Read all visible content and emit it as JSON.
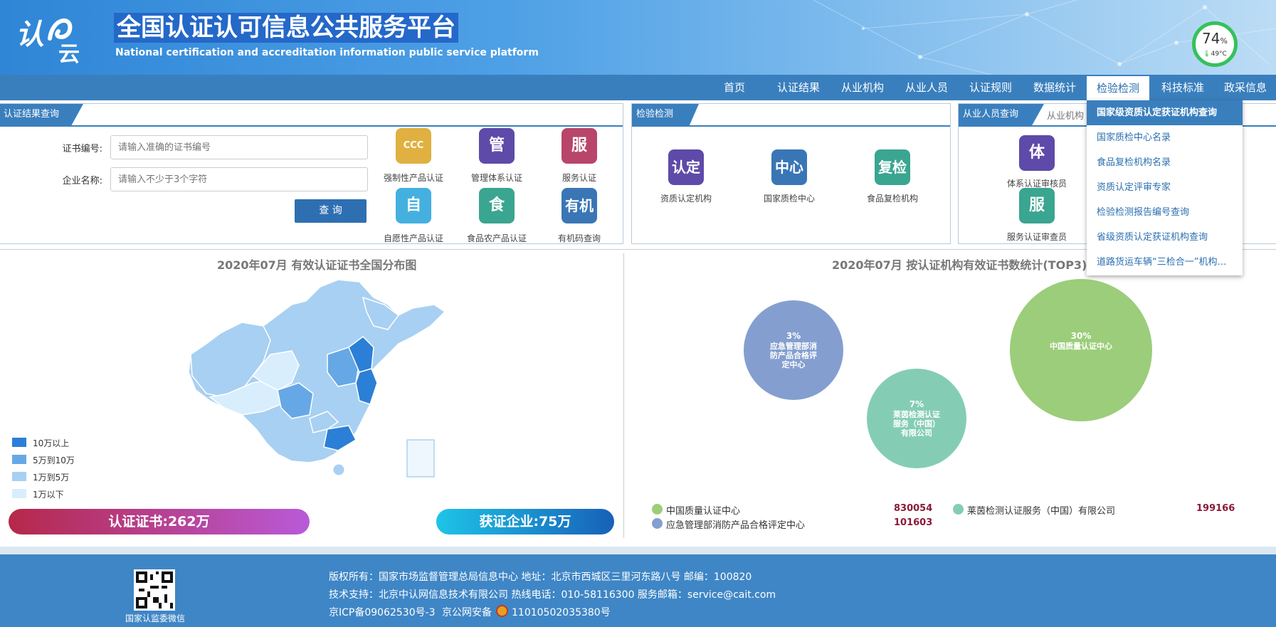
{
  "header": {
    "title_cn": "全国认证认可信息公共服务平台",
    "title_en": "National certification and accreditation information public service platform",
    "logo_text": "认e云",
    "gauge": {
      "percent": "74",
      "percent_unit": "%",
      "temp": "49°C"
    }
  },
  "nav": [
    {
      "label": "首页"
    },
    {
      "label": "认证结果"
    },
    {
      "label": "从业机构"
    },
    {
      "label": "从业人员"
    },
    {
      "label": "认证规则"
    },
    {
      "label": "数据统计"
    },
    {
      "label": "检验检测"
    },
    {
      "label": "科技标准"
    },
    {
      "label": "政采信息"
    }
  ],
  "dropdown": [
    {
      "label": "国家级资质认定获证机构查询"
    },
    {
      "label": "国家质检中心名录"
    },
    {
      "label": "食品复检机构名录"
    },
    {
      "label": "资质认定评审专家"
    },
    {
      "label": "检验检测报告编号查询"
    },
    {
      "label": "省级资质认定获证机构查询"
    },
    {
      "label": "道路货运车辆“三检合一”机构…"
    }
  ],
  "panel1": {
    "tab": "认证结果查询",
    "cert_label": "证书编号:",
    "cert_placeholder": "请输入准确的证书编号",
    "company_label": "企业名称:",
    "company_placeholder": "请输入不少于3个字符",
    "query_button": "查 询",
    "icons": [
      {
        "glyph": "CCC",
        "caption": "强制性产品认证",
        "color": "#e0b040"
      },
      {
        "glyph": "管",
        "caption": "管理体系认证",
        "color": "#5e4aa8"
      },
      {
        "glyph": "服",
        "caption": "服务认证",
        "color": "#b8466a"
      },
      {
        "glyph": "自",
        "caption": "自愿性产品认证",
        "color": "#44b0e0"
      },
      {
        "glyph": "食",
        "caption": "食品农产品认证",
        "color": "#3aa590"
      },
      {
        "glyph": "有机",
        "caption": "有机码查询",
        "color": "#3a76b5"
      }
    ]
  },
  "panel2": {
    "tab": "检验检测",
    "icons": [
      {
        "glyph": "认定",
        "caption": "资质认定机构",
        "color": "#5e4aa8"
      },
      {
        "glyph": "中心",
        "caption": "国家质检中心",
        "color": "#3a76b5"
      },
      {
        "glyph": "复检",
        "caption": "食品复检机构",
        "color": "#3aa590"
      }
    ]
  },
  "panel3": {
    "tab": "从业人员查询",
    "tab2": "从业机构",
    "icons": [
      {
        "glyph": "体",
        "caption": "体系认证审核员",
        "color": "#5e4aa8"
      },
      {
        "glyph": "服",
        "caption": "服务认证审查员",
        "color": "#3aa590"
      }
    ]
  },
  "map_section": {
    "title": "2020年07月  有效认证证书全国分布图",
    "legend": [
      {
        "label": "10万以上",
        "color": "#2b7fd6"
      },
      {
        "label": "5万到10万",
        "color": "#66a8e6"
      },
      {
        "label": "1万到5万",
        "color": "#a8d0f2"
      },
      {
        "label": "1万以下",
        "color": "#d8eefc"
      }
    ],
    "cert_total": "认证证书:262万",
    "company_total": "获证企业:75万"
  },
  "chart_data": {
    "type": "bubble",
    "title": "2020年07月   按认证机构有效证书数统计(TOP3)",
    "series": [
      {
        "name": "中国质量认证中心",
        "value": 830054,
        "percent": "30%",
        "bubble_label": "中国质量认证中心",
        "color": "#9ccd7a"
      },
      {
        "name": "莱茵检测认证服务（中国）有限公司",
        "value": 199166,
        "percent": "7%",
        "bubble_label": "莱茵检测认证服务（中国）有限公司",
        "color": "#84cdb4"
      },
      {
        "name": "应急管理部消防产品合格评定中心",
        "value": 101603,
        "percent": "3%",
        "bubble_label": "应急管理部消防产品合格评定中心",
        "color": "#849fcf"
      }
    ],
    "values_text": [
      "830054",
      "199166",
      "101603"
    ]
  },
  "footer": {
    "qr_caption": "国家认监委微信",
    "line1": "版权所有：国家市场监督管理总局信息中心    地址：北京市西城区三里河东路八号    邮编：100820",
    "line2": "技术支持：北京中认网信息技术有限公司    热线电话：010-58116300    服务邮箱：service@cait.com",
    "icp": "京ICP备09062530号-3",
    "police": "京公网安备",
    "police_num": "11010502035380号"
  }
}
